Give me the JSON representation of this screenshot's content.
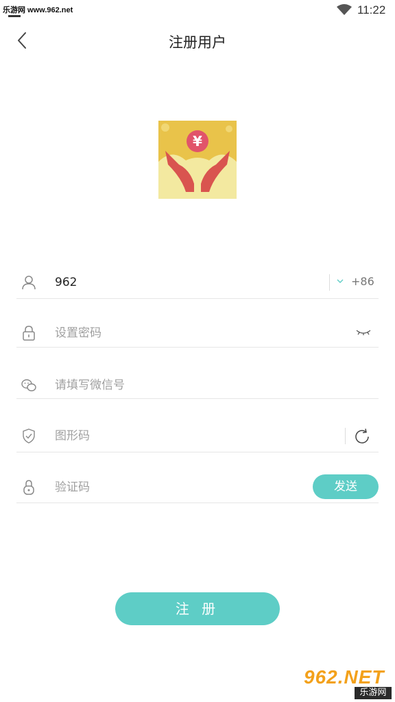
{
  "status_bar": {
    "watermark": "乐游网 www.962.net",
    "time": "11:22"
  },
  "header": {
    "title": "注册用户"
  },
  "form": {
    "phone": {
      "value": "962",
      "country_code": "+86"
    },
    "password": {
      "placeholder": "设置密码"
    },
    "wechat": {
      "placeholder": "请填写微信号"
    },
    "captcha": {
      "placeholder": "图形码"
    },
    "sms_code": {
      "placeholder": "验证码",
      "send_label": "发送"
    }
  },
  "register_label": "注 册",
  "corner_watermark": {
    "main": "962.NET",
    "sub": "乐游网"
  },
  "colors": {
    "accent": "#5ecdc6",
    "icon": "#888888"
  },
  "icons": {
    "back": "back-arrow-icon",
    "user": "user-icon",
    "lock": "lock-icon",
    "wechat": "wechat-icon",
    "shield": "shield-icon",
    "padlock": "padlock-icon",
    "eye": "eye-closed-icon",
    "refresh": "refresh-icon"
  }
}
